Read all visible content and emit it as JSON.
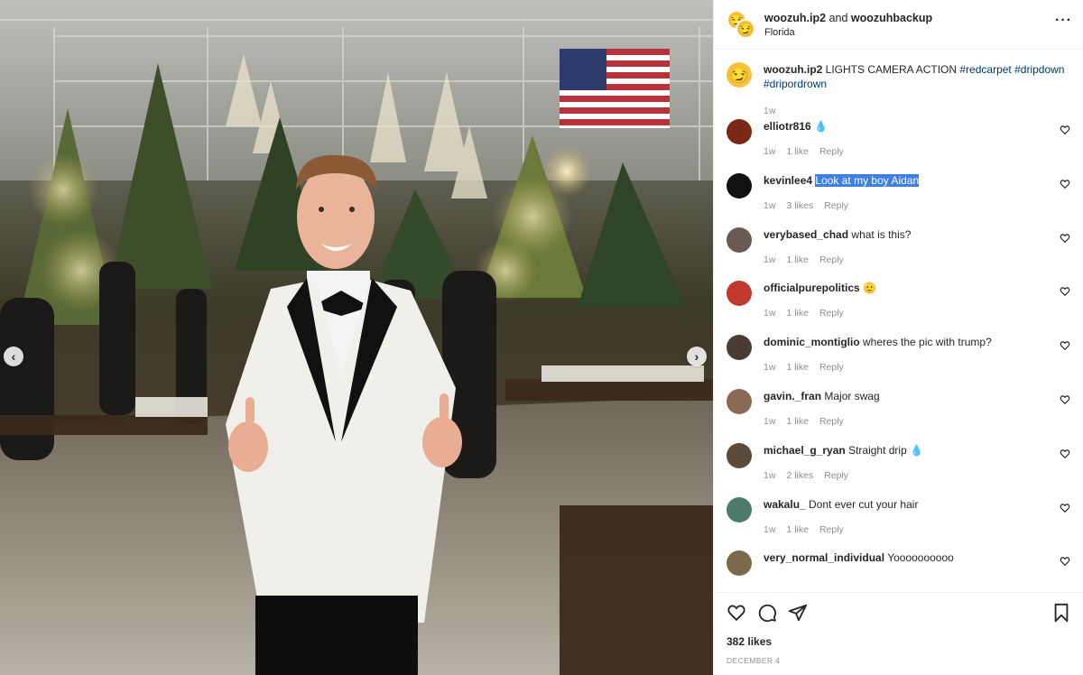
{
  "photo": {
    "prev_label": "‹",
    "next_label": "›"
  },
  "header": {
    "author": "woozuh.ip2",
    "joiner": " and ",
    "collaborator": "woozuhbackup",
    "location": "Florida",
    "more_label": "···"
  },
  "caption": {
    "user": "woozuh.ip2",
    "text": "LIGHTS CAMERA ACTION",
    "tags": [
      "#redcarpet",
      "#dripdown",
      "#dripordrown"
    ],
    "time": "1w"
  },
  "comments": [
    {
      "user": "elliotr816",
      "text": "",
      "emoji": "💧",
      "time": "1w",
      "likes": "1 like",
      "reply": "Reply",
      "avatar_color": "#7a2a14"
    },
    {
      "user": "kevinlee4",
      "text": "Look at my boy Aidan",
      "highlighted": true,
      "time": "1w",
      "likes": "3 likes",
      "reply": "Reply",
      "avatar_color": "#111111"
    },
    {
      "user": "verybased_chad",
      "text": "what is this?",
      "time": "1w",
      "likes": "1 like",
      "reply": "Reply",
      "avatar_color": "#6b5a52"
    },
    {
      "user": "officialpurepolitics",
      "text": "",
      "emoji": "🫡",
      "time": "1w",
      "likes": "1 like",
      "reply": "Reply",
      "avatar_color": "#c0392b"
    },
    {
      "user": "dominic_montiglio",
      "text": "wheres the pic with trump?",
      "time": "1w",
      "likes": "1 like",
      "reply": "Reply",
      "avatar_color": "#4a3c33"
    },
    {
      "user": "gavin._fran",
      "text": "Major swag",
      "time": "1w",
      "likes": "1 like",
      "reply": "Reply",
      "avatar_color": "#8a6a55"
    },
    {
      "user": "michael_g_ryan",
      "text": "Straight drip",
      "emoji": "💧",
      "time": "1w",
      "likes": "2 likes",
      "reply": "Reply",
      "avatar_color": "#5c4a3a"
    },
    {
      "user": "wakalu_",
      "text": "Dont ever cut your hair",
      "time": "1w",
      "likes": "1 like",
      "reply": "Reply",
      "avatar_color": "#4e7a6a"
    },
    {
      "user": "very_normal_individual",
      "text": "Yoooooooooo",
      "time": "",
      "likes": "",
      "reply": "",
      "avatar_color": "#7a6a4a"
    }
  ],
  "actions": {
    "likes": "382 likes",
    "date": "DECEMBER 4"
  },
  "colors": {
    "link": "#00376b",
    "highlight": "#3d7fe8",
    "meta": "#8e8e8e"
  }
}
